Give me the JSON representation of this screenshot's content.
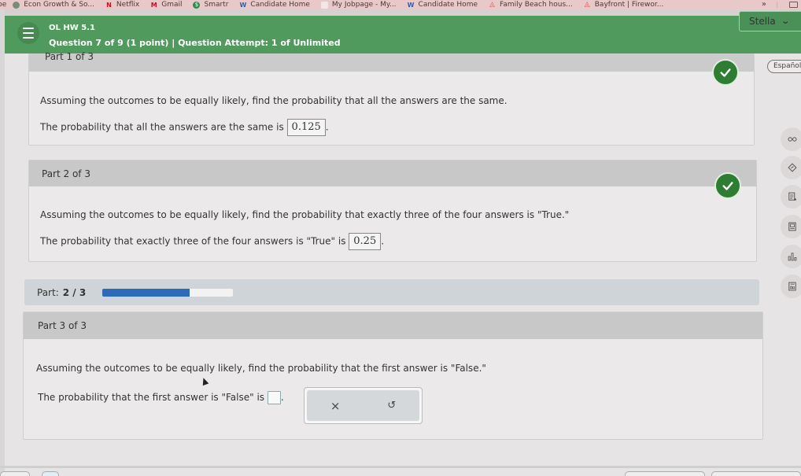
{
  "bookmarks": [
    {
      "label": "be",
      "icon": "partial-icon"
    },
    {
      "label": "Econ Growth & So...",
      "icon": "chatgpt-icon"
    },
    {
      "label": "Netflix",
      "icon": "netflix-icon"
    },
    {
      "label": "Gmail",
      "icon": "gmail-icon"
    },
    {
      "label": "Smartr",
      "icon": "smartr-icon"
    },
    {
      "label": "Candidate Home",
      "icon": "workday-icon"
    },
    {
      "label": "My Jobpage - My...",
      "icon": "page-icon"
    },
    {
      "label": "Candidate Home",
      "icon": "workday-icon"
    },
    {
      "label": "Family Beach hous...",
      "icon": "airbnb-icon"
    },
    {
      "label": "Bayfront | Firewor...",
      "icon": "airbnb-icon"
    }
  ],
  "bookmarks_more": "»",
  "header": {
    "assignment": "OL HW 5.1",
    "question_info": "Question 7 of 9 (1 point)  |  Question Attempt: 1 of Unlimited",
    "user_name": "Stella",
    "user_chevron": "❯"
  },
  "language_button": "Español",
  "parts": [
    {
      "title": "Part 1 of 3",
      "question": "Assuming the outcomes to be equally likely, find the probability that all the answers are the same.",
      "answer_prefix": "The probability that all the answers are the same is",
      "answer": "0.125",
      "status": "correct"
    },
    {
      "title": "Part 2 of 3",
      "question": "Assuming the outcomes to be equally likely, find the probability that exactly three of the four answers is \"True.\"",
      "answer_prefix": "The probability that exactly three of the four answers is \"True\" is",
      "answer": "0.25",
      "status": "correct"
    },
    {
      "title": "Part 3 of 3",
      "question": "Assuming the outcomes to be equally likely, find the probability that the first answer is \"False.\"",
      "answer_prefix": "The probability that the first answer is \"False\" is",
      "answer": "",
      "status": "unanswered"
    }
  ],
  "progress": {
    "label": "Part:",
    "value": "2 / 3",
    "fraction": 0.6667
  },
  "actions": {
    "clear": "×",
    "undo": "↺"
  },
  "punctuation": ".",
  "sidebar_tools": [
    "glasses-icon",
    "eraser-icon",
    "notes-icon",
    "calculator-icon",
    "chart-icon",
    "formula-icon"
  ],
  "colors": {
    "header_green": "#4f9a5c",
    "check_green": "#2e7d32",
    "progress_blue": "#2d6bb8"
  }
}
